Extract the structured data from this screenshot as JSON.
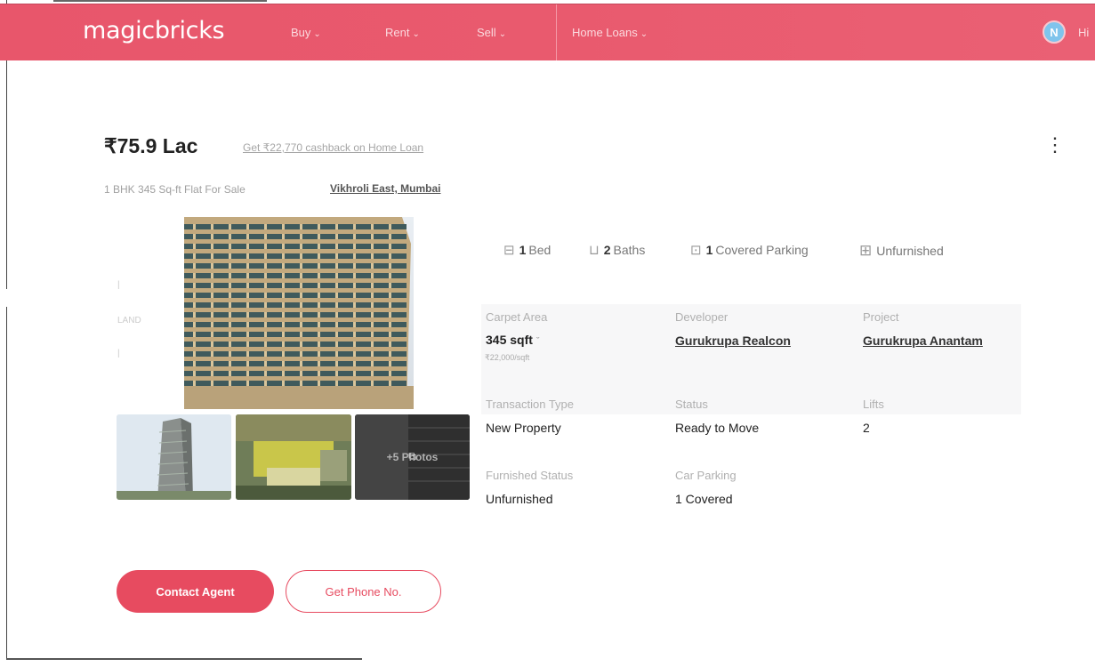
{
  "nav": {
    "logo": "magicbricks",
    "items": [
      {
        "label": "Buy"
      },
      {
        "label": "Rent"
      },
      {
        "label": "Sell"
      },
      {
        "label": "Home Loans"
      }
    ],
    "avatar_initial": "N",
    "avatar_text": "Hi"
  },
  "listing": {
    "price": "₹75.9 Lac",
    "cashback": "Get ₹22,770 cashback on Home Loan",
    "subtitle": "1 BHK 345 Sq-ft Flat For Sale",
    "locality": "Vikhroli East, Mumbai",
    "more_photos": "+5 Photos"
  },
  "amenities": [
    {
      "icon": "bed-icon",
      "count": "1",
      "label": "Bed"
    },
    {
      "icon": "bath-icon",
      "count": "2",
      "label": "Baths"
    },
    {
      "icon": "car-icon",
      "count": "1",
      "label": "Covered Parking"
    },
    {
      "icon": "wardrobe-icon",
      "count": "",
      "label": "Unfurnished"
    }
  ],
  "details": {
    "carpet_area": {
      "label": "Carpet Area",
      "value": "345 sqft",
      "rate": "₹22,000/sqft"
    },
    "developer": {
      "label": "Developer",
      "value": "Gurukrupa Realcon"
    },
    "project": {
      "label": "Project",
      "value": "Gurukrupa Anantam"
    },
    "transaction_type": {
      "label": "Transaction Type",
      "value": "New Property"
    },
    "status": {
      "label": "Status",
      "value": "Ready to Move"
    },
    "lifts": {
      "label": "Lifts",
      "value": "2"
    },
    "furnished_status": {
      "label": "Furnished Status",
      "value": "Unfurnished"
    },
    "car_parking": {
      "label": "Car Parking",
      "value": "1 Covered"
    }
  },
  "actions": {
    "contact_agent": "Contact Agent",
    "get_phone": "Get Phone No."
  },
  "colors": {
    "brand": "#e8566b",
    "button": "#e74b60"
  }
}
